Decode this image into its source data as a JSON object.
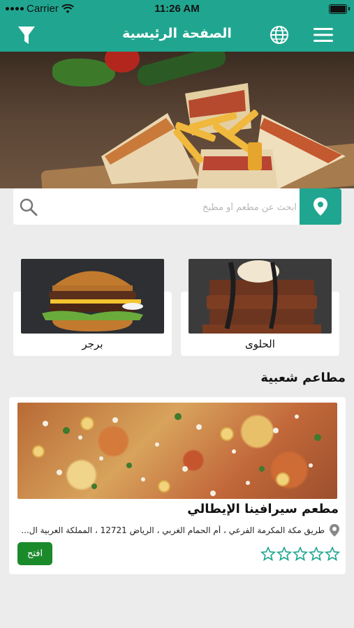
{
  "status_bar": {
    "carrier": "Carrier",
    "time": "11:26 AM"
  },
  "nav": {
    "title": "الصفحة الرئيسية",
    "left_icon": "filter-icon",
    "right_icons": [
      "globe-icon",
      "menu-icon"
    ]
  },
  "search": {
    "placeholder": "ابحث عن مطعم أو مطبخ",
    "value": ""
  },
  "categories": [
    {
      "label": "الحلوى",
      "icon": "dessert-image"
    },
    {
      "label": "برجر",
      "icon": "burger-image"
    }
  ],
  "section_title": "مطاعم شعبية",
  "restaurants": [
    {
      "name": "مطعم سيرافينا الإيطالي",
      "address": "طريق مكة المكرمة الفرعي ، أم الحمام الغربي ، الرياض 12721 ، المملكة العربية ال...",
      "status": "افتح",
      "rating": 0,
      "max_rating": 5
    }
  ],
  "colors": {
    "primary": "#20a690",
    "open_button": "#1b8a2b",
    "background": "#ececec"
  }
}
